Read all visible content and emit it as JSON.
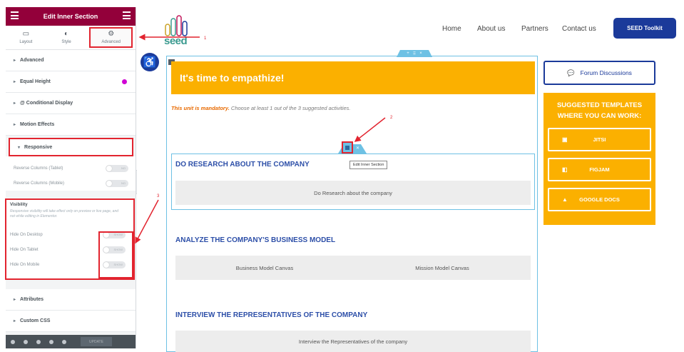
{
  "panel": {
    "title": "Edit Inner Section",
    "tabs": [
      {
        "label": "Layout",
        "icon": "layout-icon"
      },
      {
        "label": "Style",
        "icon": "style-icon"
      },
      {
        "label": "Advanced",
        "icon": "gear-icon"
      }
    ],
    "sections": [
      {
        "label": "Advanced"
      },
      {
        "label": "Equal Height"
      },
      {
        "label": "@ Conditional Display"
      },
      {
        "label": "Motion Effects"
      },
      {
        "label": "Responsive"
      }
    ],
    "responsive": {
      "rows": [
        {
          "label": "Reverse Columns (Tablet)",
          "toggle": "NO"
        },
        {
          "label": "Reverse Columns (Mobile)",
          "toggle": "NO"
        }
      ]
    },
    "visibility": {
      "title": "Visibility",
      "description": "Responsive visibility will take effect only on preview or live page, and not while editing in Elementor.",
      "rows": [
        {
          "label": "Hide On Desktop",
          "toggle": "SHOW"
        },
        {
          "label": "Hide On Tablet",
          "toggle": "SHOW"
        },
        {
          "label": "Hide On Mobile",
          "toggle": "SHOW"
        }
      ]
    },
    "lower_sections": [
      {
        "label": "Attributes"
      },
      {
        "label": "Custom CSS"
      }
    ],
    "footer": {
      "update_label": "UPDATE"
    }
  },
  "site": {
    "logo_text": "seed",
    "nav": [
      "Home",
      "About us",
      "Partners",
      "Contact us"
    ],
    "cta": "SEED Toolkit",
    "banner": "It's time to empathize!",
    "mandatory_bold": "This unit is mandatory.",
    "mandatory_rest": " Choose at least 1 out of the 3 suggested activities.",
    "tooltip": "Edit Inner Section",
    "sections": [
      {
        "title": "DO RESEARCH ABOUT THE COMPANY",
        "cards": [
          "Do Research about the company"
        ]
      },
      {
        "title": "ANALYZE THE COMPANY'S BUSINESS MODEL",
        "cards": [
          "Business Model Canvas",
          "Mission Model Canvas"
        ]
      },
      {
        "title": "INTERVIEW THE REPRESENTATIVES OF THE COMPANY",
        "cards": [
          "Interview the Representatives of the company"
        ]
      }
    ],
    "sidebar": {
      "forum": "Forum Discussions",
      "templates_title": "SUGGESTED TEMPLATES WHERE YOU CAN WORK:",
      "templates": [
        "JITSI",
        "FIGJAM",
        "GOOGLE DOCS"
      ]
    }
  },
  "annotations": [
    "1",
    "2",
    "3"
  ],
  "colors": {
    "accent": "#93003a",
    "banner": "#fbb000",
    "brand": "#1b3a9a",
    "highlight": "#e2242f",
    "edit": "#6ec1e4"
  }
}
